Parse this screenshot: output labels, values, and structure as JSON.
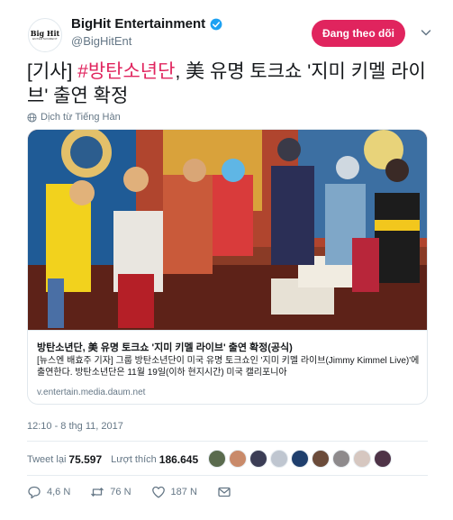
{
  "account": {
    "avatar_line1": "Big Hit",
    "avatar_line2": "ENTERTAINMENT",
    "display_name": "BigHit Entertainment",
    "handle": "@BigHitEnt",
    "follow_label": "Đang theo dõi"
  },
  "tweet": {
    "prefix": "[기사] ",
    "hashtag": "#방탄소년단",
    "rest": ", 美 유명 토크쇼 '지미 키멜 라이브' 출연 확정",
    "translate_label": "Dịch từ Tiếng Hàn"
  },
  "card": {
    "title": "방탄소년단, 美 유명 토크쇼 '지미 키멜 라이브' 출연 확정(공식)",
    "description": "[뉴스엔 배효주 기자] 그룹 방탄소년단이 미국 유명 토크쇼인 '지미 키멜 라이브(Jimmy Kimmel Live)'에 출연한다. 방탄소년단은 11월 19일(이하 현지시간) 미국 캘리포니아",
    "domain": "v.entertain.media.daum.net"
  },
  "timestamp": "12:10 - 8 thg 11, 2017",
  "stats": {
    "retweets_label": "Tweet lại",
    "retweets": "75.597",
    "likes_label": "Lượt thích",
    "likes": "186.645"
  },
  "actions": {
    "reply_count": "4,6 N",
    "retweet_count": "76 N",
    "like_count": "187 N"
  },
  "colors": {
    "accent": "#e0245e",
    "verified": "#1da1f2",
    "muted_text": "#657786"
  }
}
